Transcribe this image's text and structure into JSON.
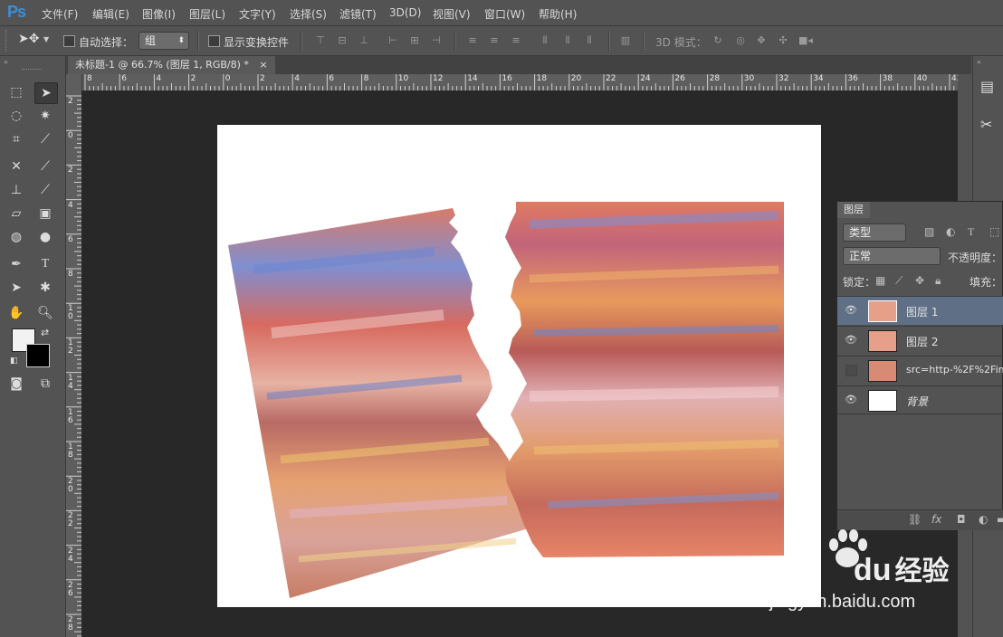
{
  "app": {
    "logo": "Ps"
  },
  "menu": [
    "文件(F)",
    "编辑(E)",
    "图像(I)",
    "图层(L)",
    "文字(Y)",
    "选择(S)",
    "滤镜(T)",
    "3D(D)",
    "视图(V)",
    "窗口(W)",
    "帮助(H)"
  ],
  "options": {
    "auto_select_label": "自动选择：",
    "auto_select_value": "组",
    "show_transform_label": "显示变换控件",
    "mode_3d_label": "3D 模式："
  },
  "document": {
    "tab_title": "未标题-1 @ 66.7% (图层 1, RGB/8) *",
    "close_glyph": "×",
    "ruler_top_labels": [
      "8",
      "6",
      "4",
      "2",
      "0",
      "2",
      "4",
      "6",
      "8",
      "10",
      "12",
      "14",
      "16",
      "18",
      "20",
      "22",
      "24",
      "26",
      "28",
      "30",
      "32",
      "34",
      "36",
      "38",
      "40",
      "42"
    ],
    "ruler_left_labels": [
      "2",
      "0",
      "2",
      "4",
      "6",
      "8",
      "10",
      "12",
      "14",
      "16",
      "18",
      "20",
      "22",
      "24",
      "26",
      "28"
    ]
  },
  "layers_panel": {
    "tab": "图层",
    "filter_kind": "类型",
    "blend_mode": "正常",
    "opacity_label": "不透明度：",
    "lock_label": "锁定：",
    "fill_label": "填充：",
    "layers": [
      {
        "name": "图层 1",
        "visible": true,
        "selected": true
      },
      {
        "name": "图层 2",
        "visible": true,
        "selected": false
      },
      {
        "name": "src=http-%2F%2Fim",
        "visible": false,
        "selected": false
      },
      {
        "name": "背景",
        "visible": true,
        "selected": false
      }
    ]
  },
  "watermark": {
    "brand": "Bai",
    "brand2": "du",
    "site_cn": "经验",
    "url": "jingyan.baidu.com"
  },
  "colors": {
    "ps_blue": "#3b8fd6",
    "selected_layer": "#5f6f85",
    "workspace": "#282828"
  }
}
